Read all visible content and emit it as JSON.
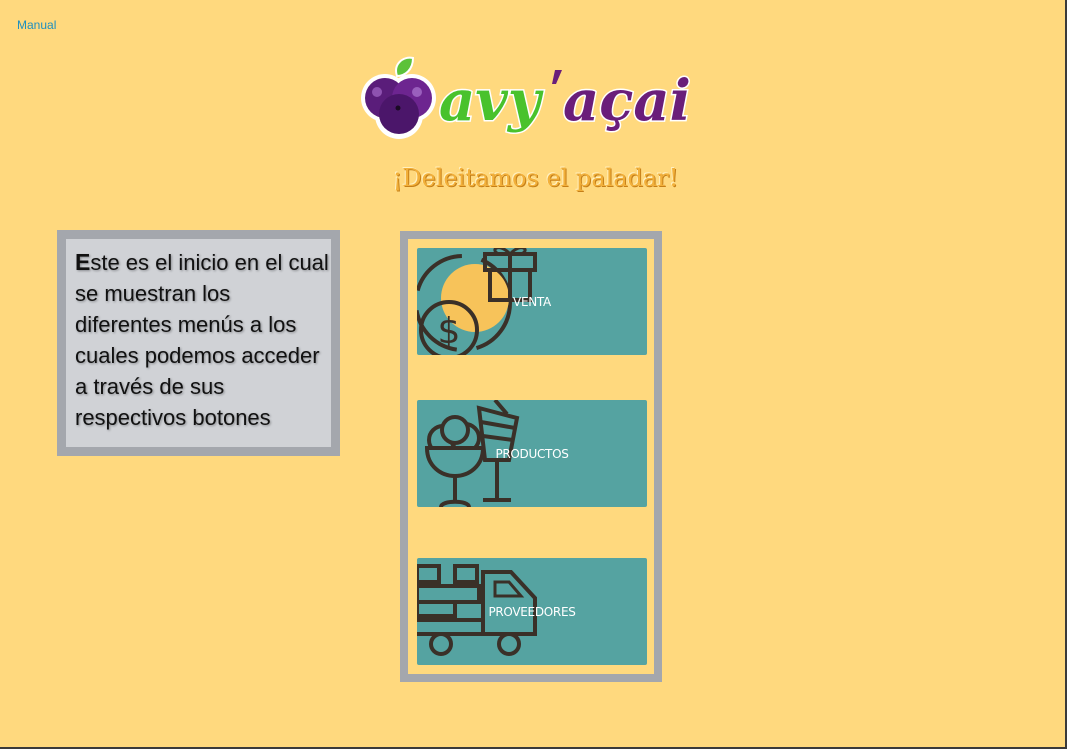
{
  "header": {
    "manual_link": "Manual"
  },
  "brand": {
    "logo_text": "avy'açai",
    "tagline": "¡Deleitamos el paladar!",
    "colors": {
      "purple": "#6a1e7a",
      "green": "#49c22c"
    }
  },
  "info": {
    "first_letter": "E",
    "text": "ste es el inicio en el cual se muestran los diferentes menús a los cuales podemos acceder a través de sus respectivos botones"
  },
  "menu": {
    "buttons": [
      {
        "label": "VENTA",
        "icon": "gift-coin-icon"
      },
      {
        "label": "PRODUCTOS",
        "icon": "ice-cream-drink-icon"
      },
      {
        "label": "PROVEEDORES",
        "icon": "delivery-truck-icon"
      }
    ]
  },
  "colors": {
    "background": "#ffd97e",
    "button": "#55a3a1",
    "panel_border": "#a4a7ad"
  }
}
